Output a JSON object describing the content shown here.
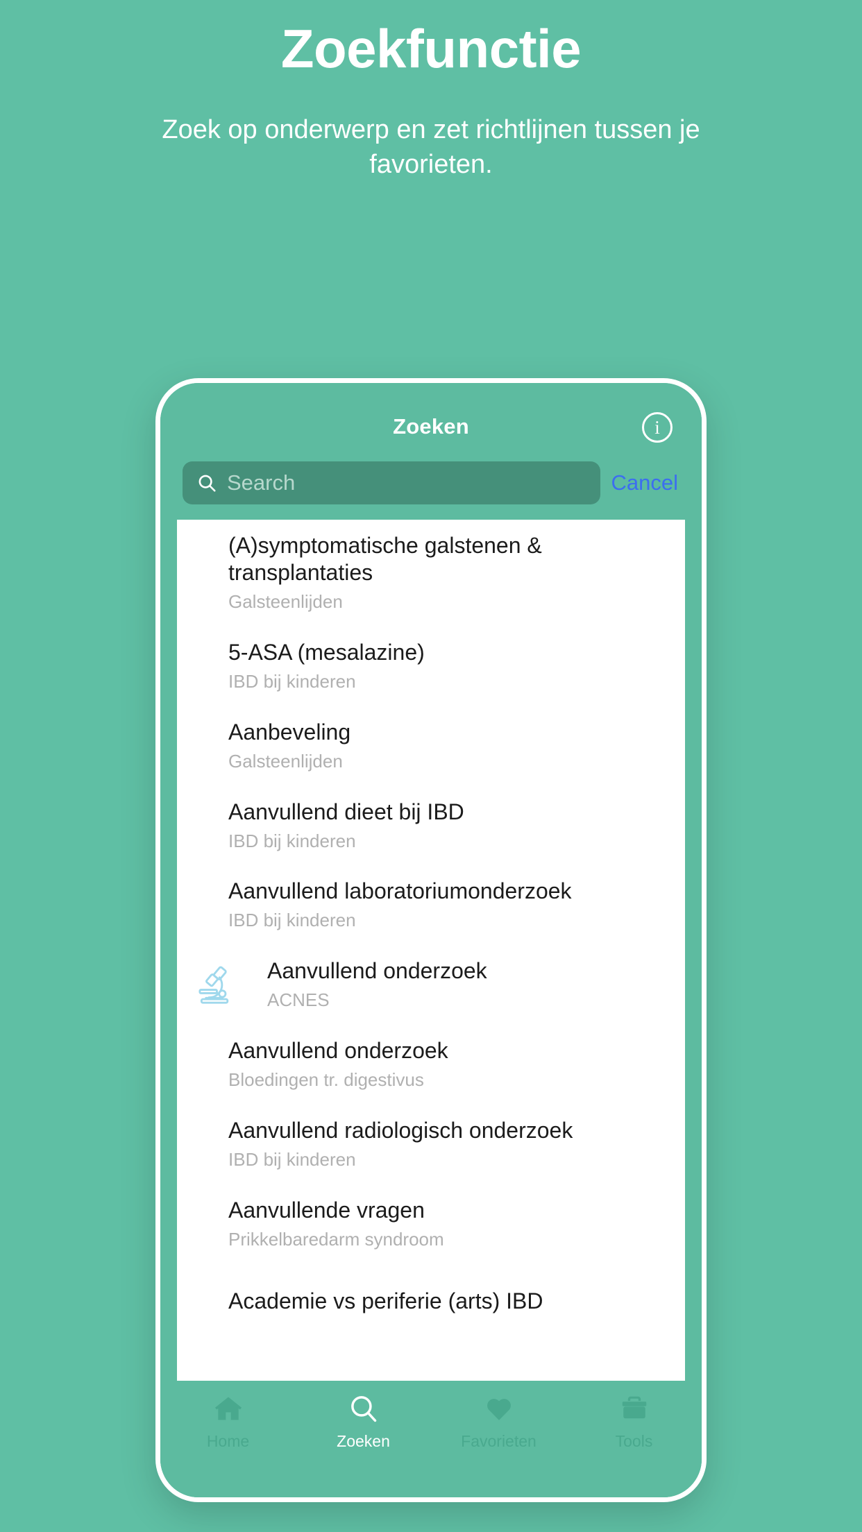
{
  "promo": {
    "title": "Zoekfunctie",
    "subtitle": "Zoek op onderwerp en zet richtlijnen tussen je favorieten."
  },
  "colors": {
    "page_background": "#5fbfa4",
    "phone_background": "#5dbba0",
    "search_field": "#45907a",
    "cancel_link": "#3c6ef0",
    "accent_olive": "#76803f",
    "accent_teal": "#5fbc9d",
    "accent_red": "#e33232",
    "accent_brown": "#8a4a0a",
    "microscope_icon": "#9fd8ec",
    "list_background": "#ffffff",
    "subtitle_grey": "#b0b0b0"
  },
  "app": {
    "navbar": {
      "title": "Zoeken",
      "info_icon": "info-circle-icon",
      "info_label": "i"
    },
    "search": {
      "icon": "search-icon",
      "placeholder": "Search",
      "value": "",
      "cancel_label": "Cancel"
    },
    "results": [
      {
        "title": "(A)symptomatische galstenen & transplantaties",
        "subtitle": "Galsteenlijden",
        "accent": "#76803f",
        "marker": "bar"
      },
      {
        "title": "5-ASA (mesalazine)",
        "subtitle": "IBD bij kinderen",
        "accent": "#5fbc9d",
        "marker": "bar"
      },
      {
        "title": "Aanbeveling",
        "subtitle": "Galsteenlijden",
        "accent": "#76803f",
        "marker": "bar"
      },
      {
        "title": "Aanvullend dieet bij IBD",
        "subtitle": "IBD bij kinderen",
        "accent": "#5fbc9d",
        "marker": "bar"
      },
      {
        "title": "Aanvullend laboratoriumonderzoek",
        "subtitle": "IBD bij kinderen",
        "accent": "#5fbc9d",
        "marker": "bar"
      },
      {
        "title": "Aanvullend onderzoek",
        "subtitle": "ACNES",
        "accent": "#9fd8ec",
        "marker": "microscope-icon"
      },
      {
        "title": "Aanvullend onderzoek",
        "subtitle": "Bloedingen tr. digestivus",
        "accent": "#e33232",
        "marker": "bar"
      },
      {
        "title": "Aanvullend radiologisch onderzoek",
        "subtitle": "IBD bij kinderen",
        "accent": "#5fbc9d",
        "marker": "bar"
      },
      {
        "title": "Aanvullende vragen",
        "subtitle": "Prikkelbaredarm syndroom",
        "accent": "#8a4a0a",
        "marker": "bar"
      },
      {
        "title": "Academie vs periferie (arts) IBD",
        "subtitle": "",
        "accent": "#5fbc9d",
        "marker": "bar"
      }
    ],
    "tabs": [
      {
        "label": "Home",
        "icon": "home-icon",
        "active": false
      },
      {
        "label": "Zoeken",
        "icon": "search-icon",
        "active": true
      },
      {
        "label": "Favorieten",
        "icon": "heart-icon",
        "active": false
      },
      {
        "label": "Tools",
        "icon": "toolbox-icon",
        "active": false
      }
    ]
  }
}
